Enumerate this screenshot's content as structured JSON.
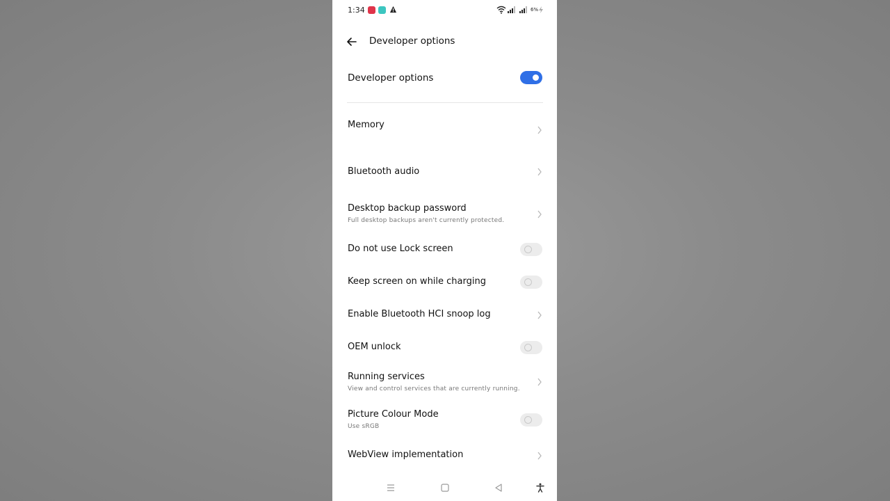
{
  "status_bar": {
    "time": "1:34",
    "battery": "6%",
    "icons": [
      "red-app-notification-icon",
      "teal-app-notification-icon",
      "warning-icon",
      "wifi-icon",
      "signal-icon",
      "signal-icon",
      "charging-bolt-icon"
    ]
  },
  "header": {
    "back_icon": "arrow-left-icon",
    "title": "Developer options"
  },
  "master_toggle": {
    "label": "Developer options",
    "state": "on",
    "accent_color": "#2f6fe6"
  },
  "settings": [
    {
      "title": "Memory",
      "subtitle": "",
      "control": "chevron"
    },
    {
      "title": "Bluetooth audio",
      "subtitle": "",
      "control": "chevron"
    },
    {
      "title": "Desktop backup password",
      "subtitle": "Full desktop backups aren't currently protected.",
      "control": "chevron"
    },
    {
      "title": "Do not use Lock screen",
      "subtitle": "",
      "control": "toggle-off"
    },
    {
      "title": "Keep screen on while charging",
      "subtitle": "",
      "control": "toggle-off"
    },
    {
      "title": "Enable Bluetooth HCI snoop log",
      "subtitle": "",
      "control": "chevron"
    },
    {
      "title": "OEM unlock",
      "subtitle": "",
      "control": "toggle-off"
    },
    {
      "title": "Running services",
      "subtitle": "View and control services that are currently running.",
      "control": "chevron"
    },
    {
      "title": "Picture Colour Mode",
      "subtitle": "Use sRGB",
      "control": "toggle-off"
    },
    {
      "title": "WebView implementation",
      "subtitle": "",
      "control": "chevron"
    }
  ],
  "nav_bar": {
    "icons": [
      "menu-icon",
      "home-square-icon",
      "back-triangle-icon",
      "accessibility-icon"
    ]
  }
}
